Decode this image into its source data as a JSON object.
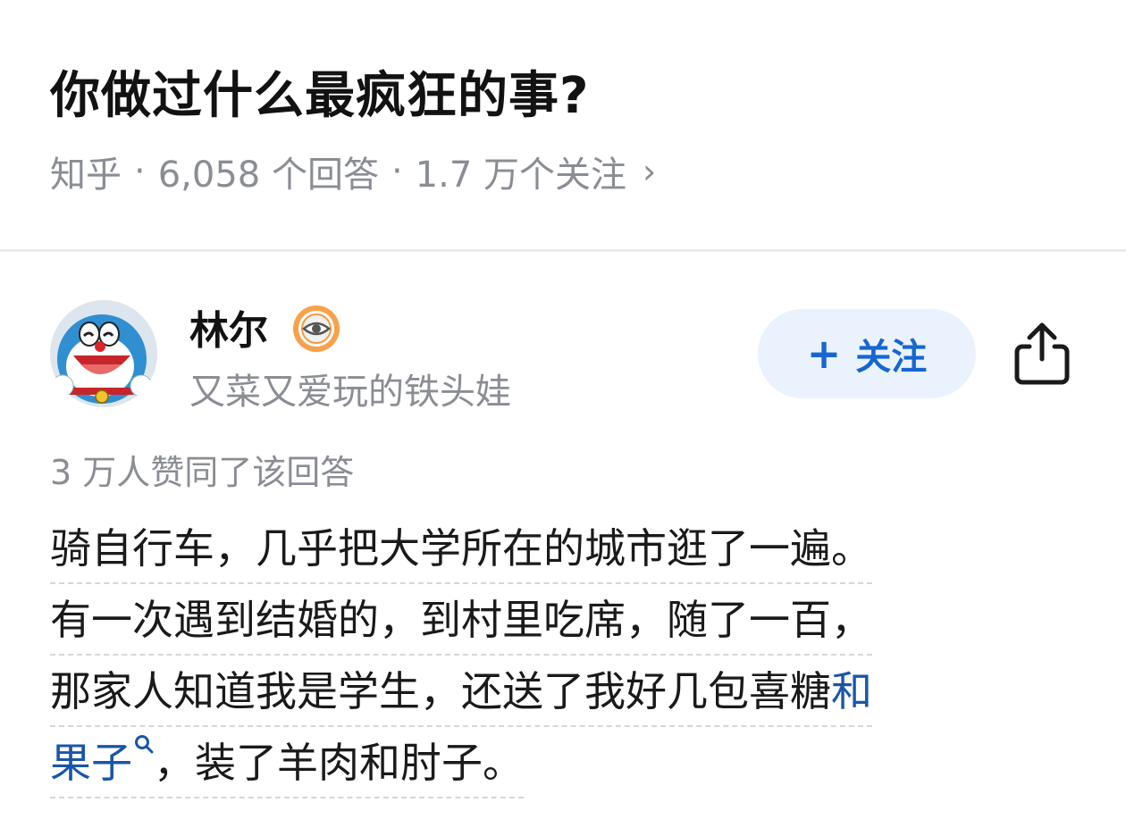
{
  "question": {
    "title": "你做过什么最疯狂的事?",
    "source": "知乎",
    "separator": "·",
    "answers": "6,058 个回答",
    "followers": "1.7 万个关注",
    "chevron": "›"
  },
  "author": {
    "name": "林尔",
    "bio": "又菜又爱玩的铁头娃",
    "avatar_icon": "doraemon-avatar",
    "badge_icon": "eye-badge-icon"
  },
  "actions": {
    "follow_plus": "+",
    "follow_label": "关注",
    "share_icon": "share-icon"
  },
  "answer": {
    "upvotes": "3 万人赞同了该回答",
    "line1": "骑自行车，几乎把大学所在的城市逛了一遍。",
    "line2": "有一次遇到结婚的，到村里吃席，随了一百，",
    "line3_text": "那家人知道我是学生，还送了我好几包喜糖",
    "link_part1": "和",
    "link_part2": "果子",
    "line4_rest": "，装了羊肉和肘子。"
  },
  "colors": {
    "accent": "#1766d0",
    "link": "#1a56a8",
    "follow_bg": "#eaf3fd",
    "muted": "#8a8d93"
  }
}
